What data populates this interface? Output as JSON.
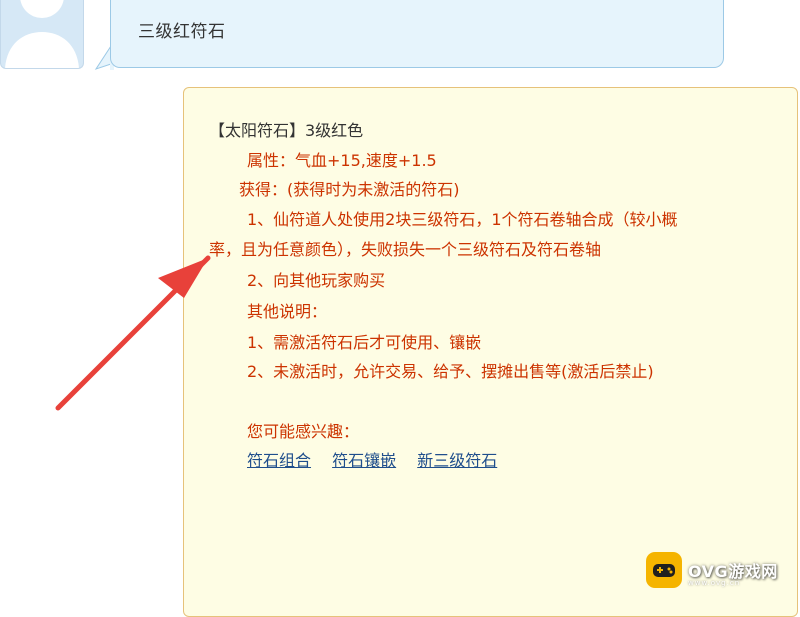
{
  "question": {
    "text": "三级红符石"
  },
  "answer": {
    "title": "【太阳符石】3级红色",
    "attributes": "属性：气血+15,速度+1.5",
    "obtain": "获得：(获得时为未激活的符石)",
    "method1_line1": "1、仙符道人处使用2块三级符石，1个符石卷轴合成（较小概",
    "method1_line2": "率，且为任意颜色），失败损失一个三级符石及符石卷轴",
    "method2": "2、向其他玩家购买",
    "other_title": "其他说明：",
    "note1": "1、需激活符石后才可使用、镶嵌",
    "note2": "2、未激活时，允许交易、给予、摆摊出售等(激活后禁止)",
    "interest": "您可能感兴趣：",
    "links": [
      "符石组合",
      "符石镶嵌",
      "新三级符石"
    ]
  },
  "watermark": {
    "text": "OVG游戏网",
    "sub": "www.ovg.cn",
    "icon": "gamepad-icon"
  },
  "colors": {
    "answer_text": "#cc3300",
    "title_text": "#333333",
    "link": "#1f4e8c",
    "card_bg": "#fefde4",
    "card_border": "#e6c27a",
    "bubble_bg": "#e6f4fc",
    "bubble_border": "#9cc9e6",
    "arrow": "#e8413a",
    "watermark_icon": "#f5b400"
  }
}
